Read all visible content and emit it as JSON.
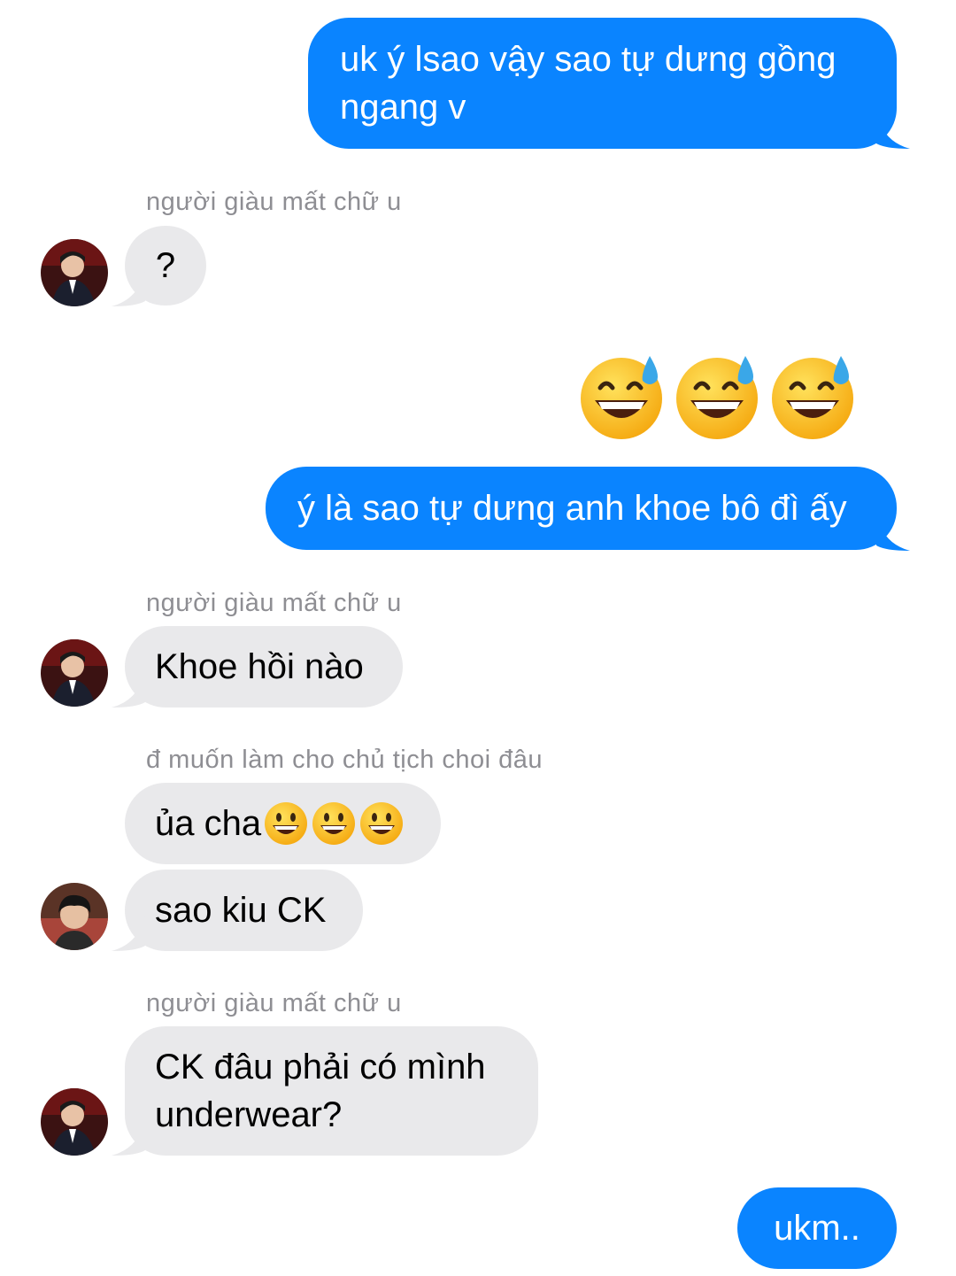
{
  "messages": {
    "m1": "uk ý lsao vậy sao tự dưng gồng ngang v",
    "s1": "người giàu mất chữ u",
    "m2": "?",
    "m3_emoji": [
      "grinning-face-with-sweat",
      "grinning-face-with-sweat",
      "grinning-face-with-sweat"
    ],
    "m4": "ý là sao tự dưng anh khoe bô đì ấy",
    "s2": "người giàu mất chữ u",
    "m5": "Khoe hồi nào",
    "s3": "đ muốn làm cho chủ tịch choi đâu",
    "m6": "ủa cha",
    "m6_emoji": [
      "smiling-face-big-eyes",
      "smiling-face-big-eyes",
      "smiling-face-big-eyes"
    ],
    "m7": "sao kiu CK",
    "s4": "người giàu mất chữ u",
    "m8": "CK đâu phải có mình underwear?",
    "m9": "ukm.."
  },
  "colors": {
    "sent_bubble": "#0a84ff",
    "received_bubble": "#e9e9eb",
    "sender_name": "#8e8e93"
  }
}
